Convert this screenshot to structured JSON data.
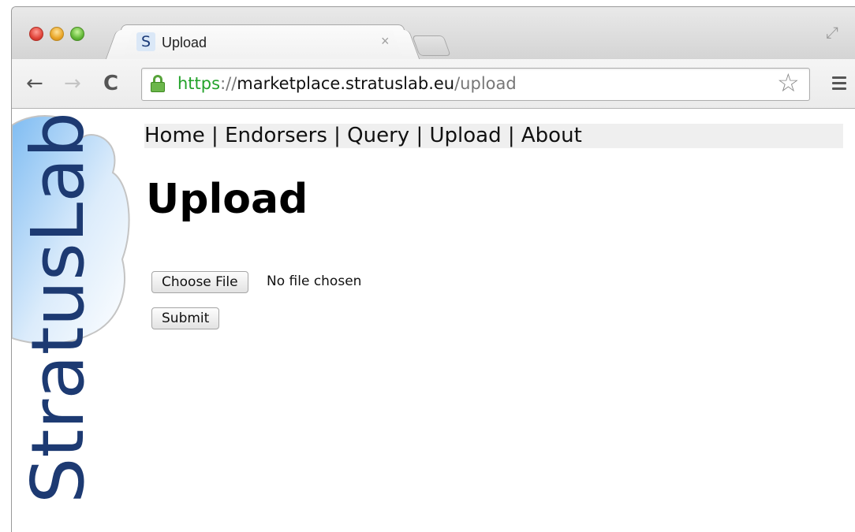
{
  "browser": {
    "tab": {
      "favicon_letter": "S",
      "title": "Upload",
      "close": "×"
    },
    "nav": {
      "back": "←",
      "forward": "→",
      "reload": "C"
    },
    "address": {
      "scheme": "https",
      "separator": "://",
      "host": "marketplace.stratuslab.eu",
      "path": "/upload"
    },
    "star": "☆",
    "fullscreen": "⤢"
  },
  "page": {
    "logo_text": "StratusLab",
    "nav": {
      "home": "Home",
      "endorsers": "Endorsers",
      "query": "Query",
      "upload": "Upload",
      "about": "About",
      "separator": " | "
    },
    "heading": "Upload",
    "form": {
      "choose_file_label": "Choose File",
      "no_file_text": "No file chosen",
      "submit_label": "Submit"
    }
  },
  "colors": {
    "logo_text": "#1d3a72",
    "cloud_fill": "#cfe6fb",
    "https_green": "#24a32b"
  }
}
